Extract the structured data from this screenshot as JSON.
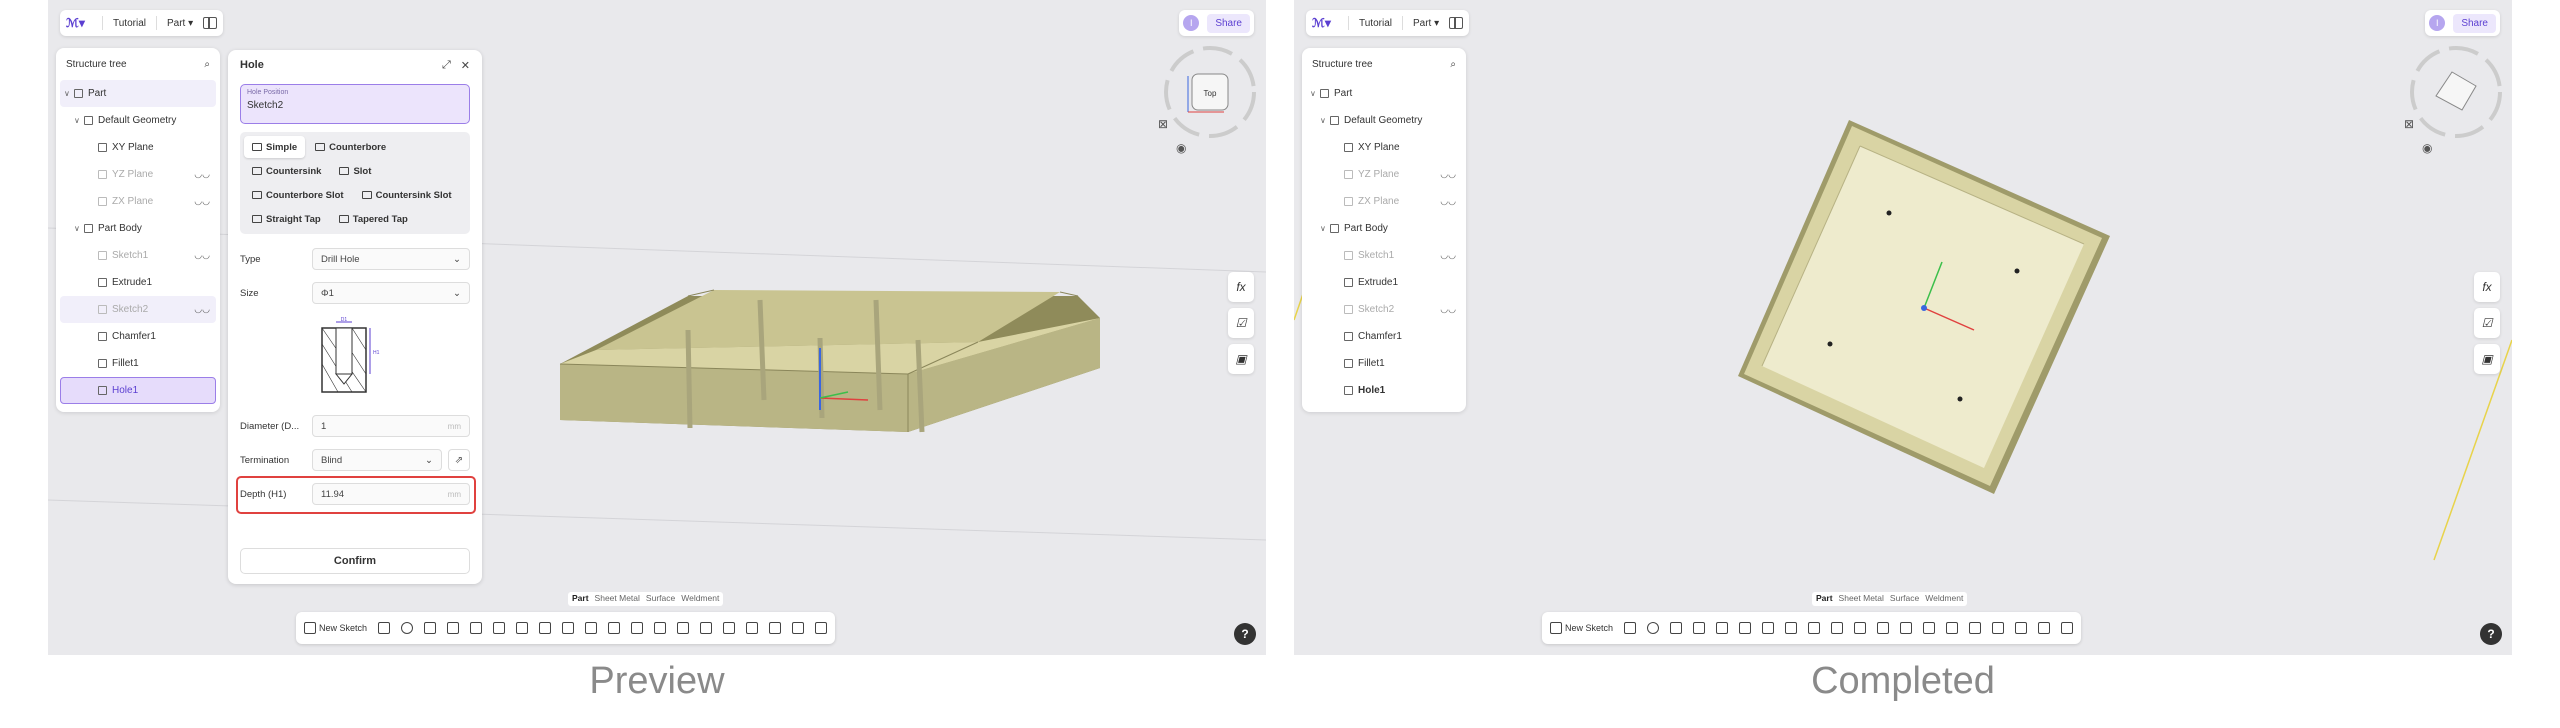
{
  "left": {
    "caption": "Preview",
    "topbar": {
      "crumb_tutorial": "Tutorial",
      "crumb_part": "Part"
    },
    "avatar": "I",
    "share": "Share",
    "tree": {
      "title": "Structure tree",
      "items": [
        {
          "label": "Part"
        },
        {
          "label": "Default Geometry"
        },
        {
          "label": "XY Plane"
        },
        {
          "label": "YZ Plane"
        },
        {
          "label": "ZX Plane"
        },
        {
          "label": "Part Body"
        },
        {
          "label": "Sketch1"
        },
        {
          "label": "Extrude1"
        },
        {
          "label": "Sketch2"
        },
        {
          "label": "Chamfer1"
        },
        {
          "label": "Fillet1"
        },
        {
          "label": "Hole1"
        }
      ]
    },
    "hole": {
      "title": "Hole",
      "position_label": "Hole Position",
      "position_value": "Sketch2",
      "types": [
        "Simple",
        "Counterbore",
        "Countersink",
        "Slot",
        "Counterbore Slot",
        "Countersink Slot",
        "Straight Tap",
        "Tapered Tap"
      ],
      "type_label": "Type",
      "type_value": "Drill Hole",
      "size_label": "Size",
      "size_value": "Φ1",
      "diameter_label": "Diameter (D...",
      "diameter_value": "1",
      "diameter_unit": "mm",
      "termination_label": "Termination",
      "termination_value": "Blind",
      "depth_label": "Depth (H1)",
      "depth_value": "11.94",
      "depth_unit": "mm",
      "confirm": "Confirm",
      "diagram_d": "D1",
      "diagram_h": "H1"
    },
    "modes": [
      "Part",
      "Sheet Metal",
      "Surface",
      "Weldment"
    ],
    "new_sketch": "New Sketch",
    "help": "?"
  },
  "right": {
    "caption": "Completed",
    "topbar": {
      "crumb_tutorial": "Tutorial",
      "crumb_part": "Part"
    },
    "avatar": "I",
    "share": "Share",
    "tree": {
      "title": "Structure tree",
      "items": [
        {
          "label": "Part"
        },
        {
          "label": "Default Geometry"
        },
        {
          "label": "XY Plane"
        },
        {
          "label": "YZ Plane"
        },
        {
          "label": "ZX Plane"
        },
        {
          "label": "Part Body"
        },
        {
          "label": "Sketch1"
        },
        {
          "label": "Extrude1"
        },
        {
          "label": "Sketch2"
        },
        {
          "label": "Chamfer1"
        },
        {
          "label": "Fillet1"
        },
        {
          "label": "Hole1"
        }
      ]
    },
    "modes": [
      "Part",
      "Sheet Metal",
      "Surface",
      "Weldment"
    ],
    "new_sketch": "New Sketch",
    "help": "?"
  },
  "viewcube": {
    "face_label": "Top"
  },
  "colors": {
    "accent": "#5b3fd1",
    "highlight_box": "#e0413f",
    "model": "#c9c491",
    "model_dark": "#8f8b5a"
  }
}
